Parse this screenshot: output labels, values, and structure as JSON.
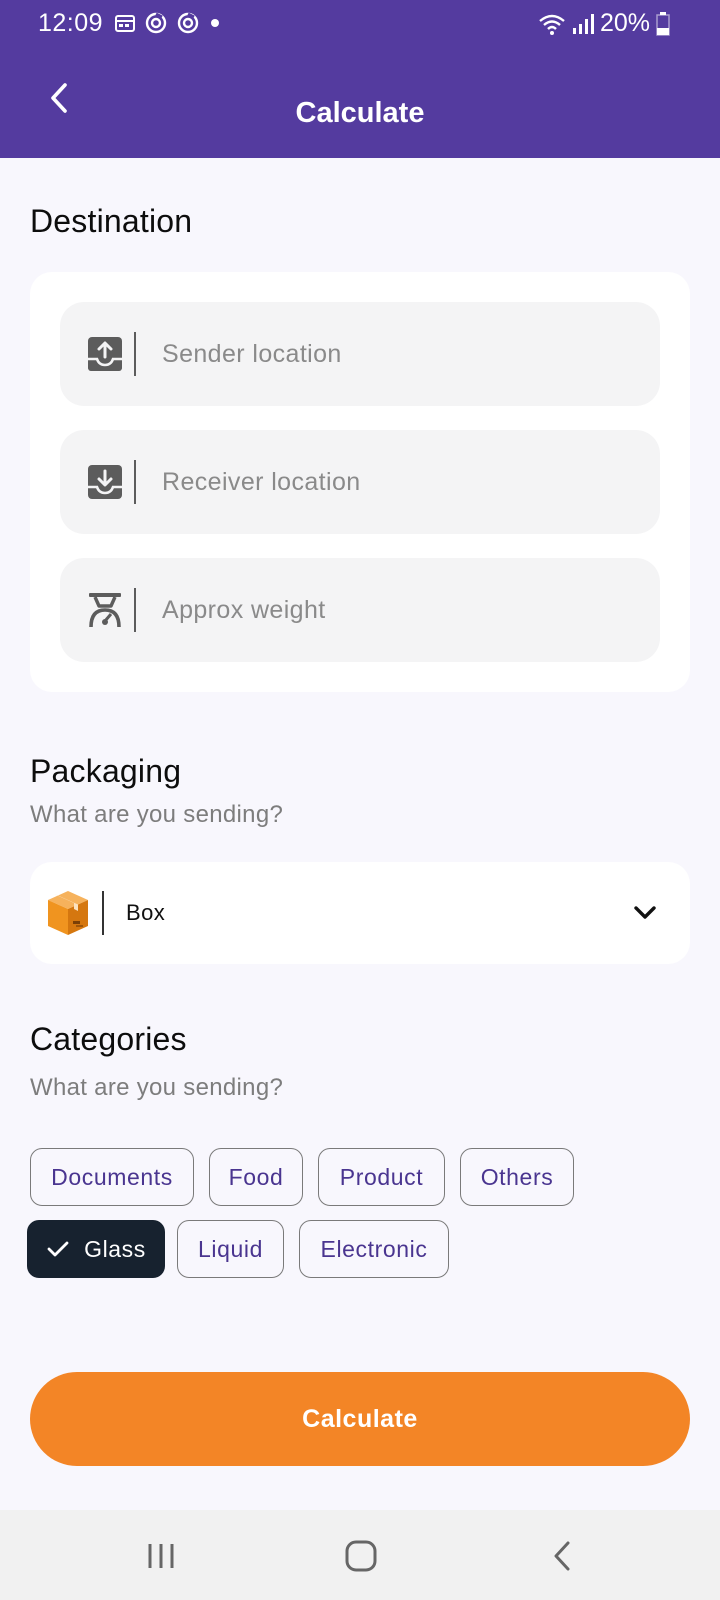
{
  "status_bar": {
    "time": "12:09",
    "battery": "20%",
    "icons": [
      "calendar-icon",
      "sync-icon",
      "sync-icon",
      "dot-icon",
      "wifi-icon",
      "signal-icon",
      "battery-icon"
    ]
  },
  "header": {
    "title": "Calculate",
    "back_icon": "chevron-left-icon"
  },
  "destination": {
    "title": "Destination",
    "fields": [
      {
        "placeholder": "Sender location",
        "icon": "upload-tray-icon"
      },
      {
        "placeholder": "Receiver location",
        "icon": "download-tray-icon"
      },
      {
        "placeholder": "Approx weight",
        "icon": "scale-icon"
      }
    ]
  },
  "packaging": {
    "title": "Packaging",
    "subtitle": "What are you sending?",
    "selected": "Box",
    "icon": "box-icon"
  },
  "categories": {
    "title": "Categories",
    "subtitle": "What are you sending?",
    "chips": [
      "Documents",
      "Food",
      "Product",
      "Others",
      "Glass",
      "Liquid",
      "Electronic"
    ],
    "selected": "Glass"
  },
  "action": {
    "label": "Calculate"
  },
  "colors": {
    "brand": "#543b9f",
    "accent": "#f38526",
    "chip_selected": "#17222f",
    "chip_text": "#4a3590",
    "background": "#f8f7fd"
  }
}
